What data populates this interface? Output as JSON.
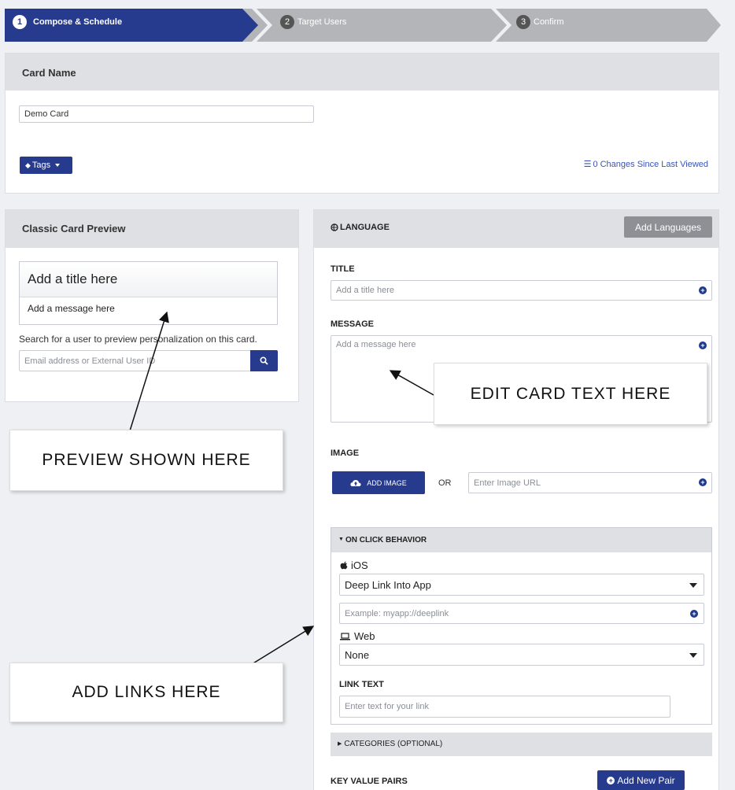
{
  "steps": [
    {
      "num": "1",
      "label": "Compose & Schedule"
    },
    {
      "num": "2",
      "label": "Target Users"
    },
    {
      "num": "3",
      "label": "Confirm"
    }
  ],
  "card_name": {
    "heading": "Card Name",
    "value": "Demo Card",
    "tags_label": "Tags",
    "changes_label": "0 Changes Since Last Viewed"
  },
  "preview": {
    "heading": "Classic Card Preview",
    "title": "Add a title here",
    "message": "Add a message here",
    "search_hint": "Search for a user to preview personalization on this card.",
    "search_placeholder": "Email address or External User ID"
  },
  "language": {
    "heading": "LANGUAGE",
    "add_languages": "Add Languages",
    "title_label": "TITLE",
    "title_placeholder": "Add a title here",
    "message_label": "MESSAGE",
    "message_placeholder": "Add a message here",
    "image_label": "IMAGE",
    "add_image": "ADD IMAGE",
    "or": "OR",
    "image_url_placeholder": "Enter Image URL"
  },
  "on_click": {
    "heading": "ON CLICK BEHAVIOR",
    "ios_label": "iOS",
    "ios_option": "Deep Link Into App",
    "deeplink_placeholder": "Example: myapp://deeplink",
    "web_label": "Web",
    "web_option": "None",
    "link_text_label": "LINK TEXT",
    "link_text_placeholder": "Enter text for your link"
  },
  "categories_label": "CATEGORIES (OPTIONAL)",
  "kv": {
    "label": "KEY VALUE PAIRS",
    "add_pair": "Add New Pair"
  },
  "callouts": {
    "edit": "EDIT CARD TEXT HERE",
    "preview": "PREVIEW SHOWN HERE",
    "links": "ADD LINKS HERE"
  },
  "colors": {
    "primary": "#263a8e",
    "step_inactive": "#b3b5b9",
    "link_blue": "#3a53b8"
  }
}
